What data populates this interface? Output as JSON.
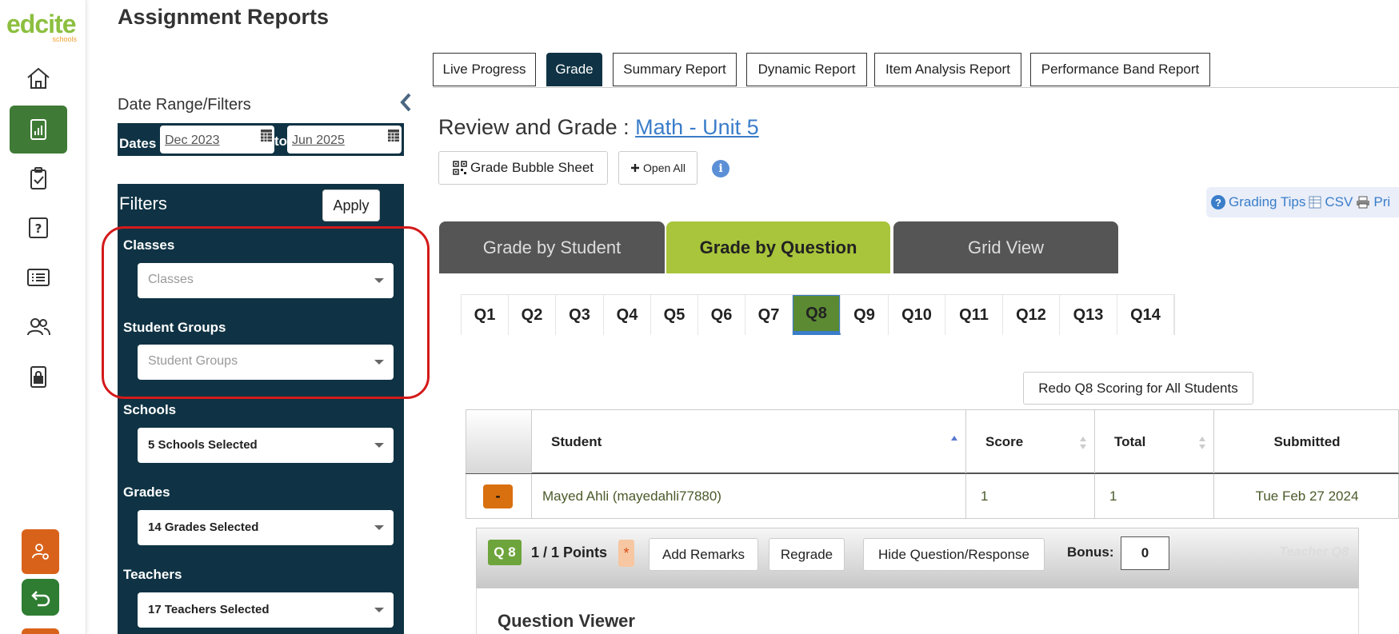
{
  "brand": {
    "name": "edcite",
    "sub": "schools"
  },
  "page_title": "Assignment Reports",
  "report_tabs": [
    "Live Progress",
    "Grade",
    "Summary Report",
    "Dynamic Report",
    "Item Analysis Report",
    "Performance Band Report"
  ],
  "report_tabs_active": "Grade",
  "sidebar_nav": [
    "home-icon",
    "reports-icon",
    "assignments-icon",
    "questions-icon",
    "list-icon",
    "users-icon",
    "lock-icon",
    "user-settings-icon",
    "back-icon"
  ],
  "date_filters": {
    "label": "Date Range/Filters",
    "dates_label": "Dates",
    "from": "Dec 2023",
    "to_label": "to",
    "to": "Jun 2025"
  },
  "filters": {
    "title": "Filters",
    "apply_label": "Apply",
    "classes": {
      "label": "Classes",
      "placeholder": "Classes"
    },
    "student_groups": {
      "label": "Student Groups",
      "placeholder": "Student Groups"
    },
    "schools": {
      "label": "Schools",
      "value": "5 Schools Selected"
    },
    "grades": {
      "label": "Grades",
      "value": "14 Grades Selected"
    },
    "teachers": {
      "label": "Teachers",
      "value": "17 Teachers Selected"
    }
  },
  "review": {
    "prefix": "Review and Grade : ",
    "assignment_link": "Math - Unit 5",
    "bubble_sheet_label": "Grade Bubble Sheet",
    "open_all_label": "Open All",
    "info_glyph": "i"
  },
  "tips_bar": {
    "grading_tips": "Grading Tips",
    "csv": "CSV",
    "print": "Pri"
  },
  "grade_tabs": [
    "Grade by Student",
    "Grade by Question",
    "Grid View"
  ],
  "grade_tabs_active": "Grade by Question",
  "question_tabs": [
    "Q1",
    "Q2",
    "Q3",
    "Q4",
    "Q5",
    "Q6",
    "Q7",
    "Q8",
    "Q9",
    "Q10",
    "Q11",
    "Q12",
    "Q13",
    "Q14"
  ],
  "question_tabs_active": "Q8",
  "redo_label": "Redo Q8 Scoring for All Students",
  "table": {
    "columns": [
      "Student",
      "Score",
      "Total",
      "Submitted"
    ],
    "rows": [
      {
        "toggle": "-",
        "student": "Mayed Ahli (mayedahli77880)",
        "score": "1",
        "total": "1",
        "submitted": "Tue Feb 27 2024"
      }
    ]
  },
  "question_panel": {
    "badge": "Q 8",
    "points": "1 / 1 Points",
    "star": "*",
    "add_remarks": "Add Remarks",
    "regrade": "Regrade",
    "hide": "Hide Question/Response",
    "bonus_label": "Bonus:",
    "bonus_value": "0",
    "watermark": "Teacher Q8"
  },
  "viewer_title": "Question Viewer",
  "colors": {
    "panel_dark": "#0f3344",
    "active_green": "#a9c53b",
    "nav_active": "#3f7a36",
    "orange": "#d9621a",
    "link_blue": "#3a7dc9",
    "highlight_red": "#d41a1a"
  }
}
